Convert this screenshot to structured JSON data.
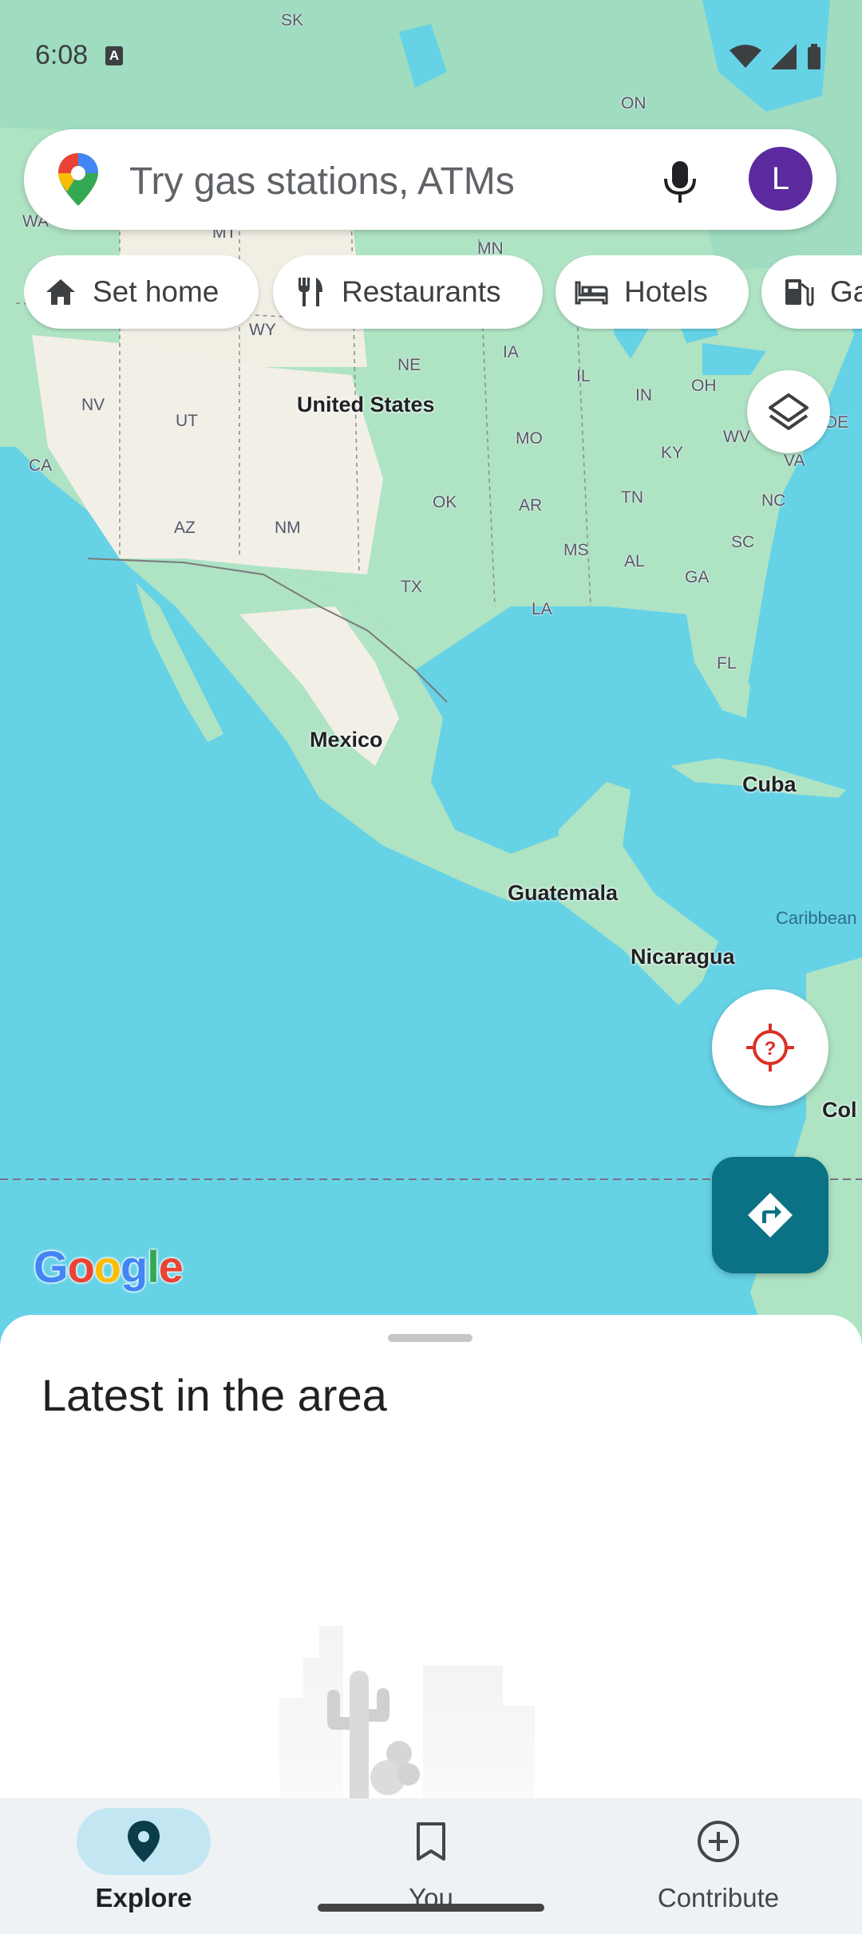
{
  "status_bar": {
    "time": "6:08",
    "notif_letter": "A"
  },
  "search": {
    "placeholder": "Try gas stations, ATMs",
    "avatar_letter": "L"
  },
  "chips": [
    {
      "label": "Set home",
      "icon": "home-icon"
    },
    {
      "label": "Restaurants",
      "icon": "restaurant-icon"
    },
    {
      "label": "Hotels",
      "icon": "hotel-icon"
    },
    {
      "label": "Ga",
      "icon": "gas-station-icon"
    }
  ],
  "map": {
    "countries": [
      "United States",
      "Mexico",
      "Cuba",
      "Guatemala",
      "Nicaragua",
      "Col"
    ],
    "states": [
      "SK",
      "ON",
      "MN",
      "WA",
      "MT",
      "WY",
      "NE",
      "IA",
      "IL",
      "IN",
      "OH",
      "NV",
      "UT",
      "CA",
      "MO",
      "KY",
      "WV",
      "VA",
      "DE",
      "AZ",
      "NM",
      "OK",
      "AR",
      "TN",
      "NC",
      "SC",
      "MS",
      "AL",
      "GA",
      "TX",
      "LA",
      "FL"
    ],
    "sea": "Caribbean"
  },
  "brand": {
    "g1": "G",
    "g2": "o",
    "g3": "o",
    "g4": "g",
    "g5": "l",
    "g6": "e"
  },
  "sheet": {
    "title": "Latest in the area"
  },
  "nav": {
    "explore": "Explore",
    "you": "You",
    "contribute": "Contribute"
  },
  "colors": {
    "water": "#66d2e6",
    "land": "#aee3c4",
    "desert": "#f2efe6",
    "accent": "#0b7285",
    "avatar": "#5a2a9e"
  }
}
